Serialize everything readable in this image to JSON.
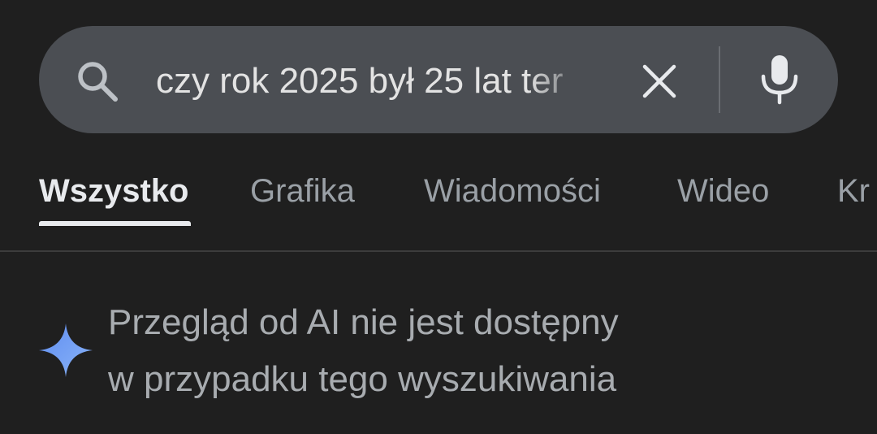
{
  "search": {
    "query": "czy rok 2025 był 25 lat ter",
    "icons": {
      "search": "search-icon",
      "clear": "close-icon",
      "voice": "microphone-icon"
    }
  },
  "tabs": [
    {
      "label": "Wszystko",
      "active": true
    },
    {
      "label": "Grafika",
      "active": false
    },
    {
      "label": "Wiadomości",
      "active": false
    },
    {
      "label": "Wideo",
      "active": false
    },
    {
      "label": "Kr",
      "active": false
    }
  ],
  "ai_overview": {
    "icon": "sparkle-icon",
    "line1": "Przegląd od AI nie jest dostępny",
    "line2": "w przypadku tego wyszukiwania"
  },
  "colors": {
    "background": "#1f1f1f",
    "search_bar": "#4b4e53",
    "sparkle": "#6b9cf5"
  }
}
